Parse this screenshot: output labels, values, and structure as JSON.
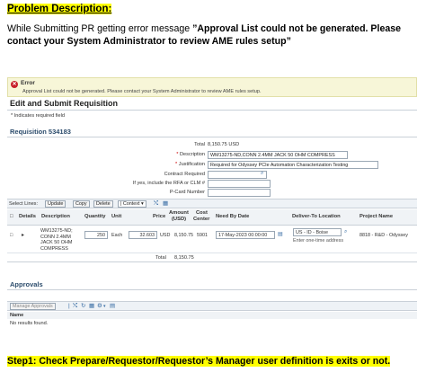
{
  "doc": {
    "heading": "Problem Description:",
    "intro_prefix": "While Submitting PR getting error message ",
    "error_quote": "”Approval List could not be generated. Please contact your System Administrator to review AME rules setup”",
    "step1": "Step1: Check Prepare/Requestor/Requestor’s Manager user definition is exits or not."
  },
  "error": {
    "icon": "error-x-icon",
    "title": "Error",
    "message": "Approval List could not be generated. Please contact your System Administrator to review AME rules setup."
  },
  "page": {
    "title": "Edit and Submit Requisition",
    "required_note": "* Indicates required field",
    "requisition_title": "Requisition 534183"
  },
  "fields": {
    "total_label": "Total",
    "total_value": "8,150.75 USD",
    "description_label": "Description",
    "description_value": "WM13275-ND,CONN 2.4MM JACK 50 OHM COMPRESS",
    "justification_label": "Justification",
    "justification_value": "Required for Odyssey PCIe Automation Characterization Testing",
    "contract_label": "Contract Required",
    "rfa_label": "If yes, include the RFA or CLM #",
    "pcard_label": "P-Card Number",
    "star": "*"
  },
  "toolbar": {
    "select_lines": "Select Lines:",
    "update": "Update",
    "copy": "Copy",
    "delete": "Delete",
    "context": "| Context",
    "context_chevron": "▾",
    "icons": [
      "split-icon",
      "calculator-icon"
    ]
  },
  "table": {
    "headers": {
      "select": "",
      "details": "Details",
      "description": "Description",
      "quantity": "Quantity",
      "unit": "Unit",
      "price": "Price",
      "amount_l1": "Amount",
      "amount_l2": "(USD)",
      "cost_l1": "Cost",
      "cost_l2": "Center",
      "need_by": "Need By Date",
      "deliver_to": "Deliver-To Location",
      "project": "Project Name"
    },
    "row": {
      "description": [
        "WM13275-ND;",
        "CONN 2.4MM",
        "JACK 50 OHM",
        "COMPRESS"
      ],
      "quantity": "250",
      "unit": "Each",
      "price": "32.603",
      "currency": "USD",
      "amount": "8,150.75",
      "cost_center": "5901",
      "need_by": "17-May-2023 00:00:00",
      "deliver_to": "US - ID - Boise",
      "deliver_hint": "Enter one-time address",
      "project": "8818 - R&D - Odyssey"
    },
    "total_label": "Total",
    "total_value": "8,150.75"
  },
  "approvals": {
    "title": "Approvals",
    "manage_button": "Manage Approvals",
    "column_name": "Name",
    "empty_text": "No results found."
  }
}
